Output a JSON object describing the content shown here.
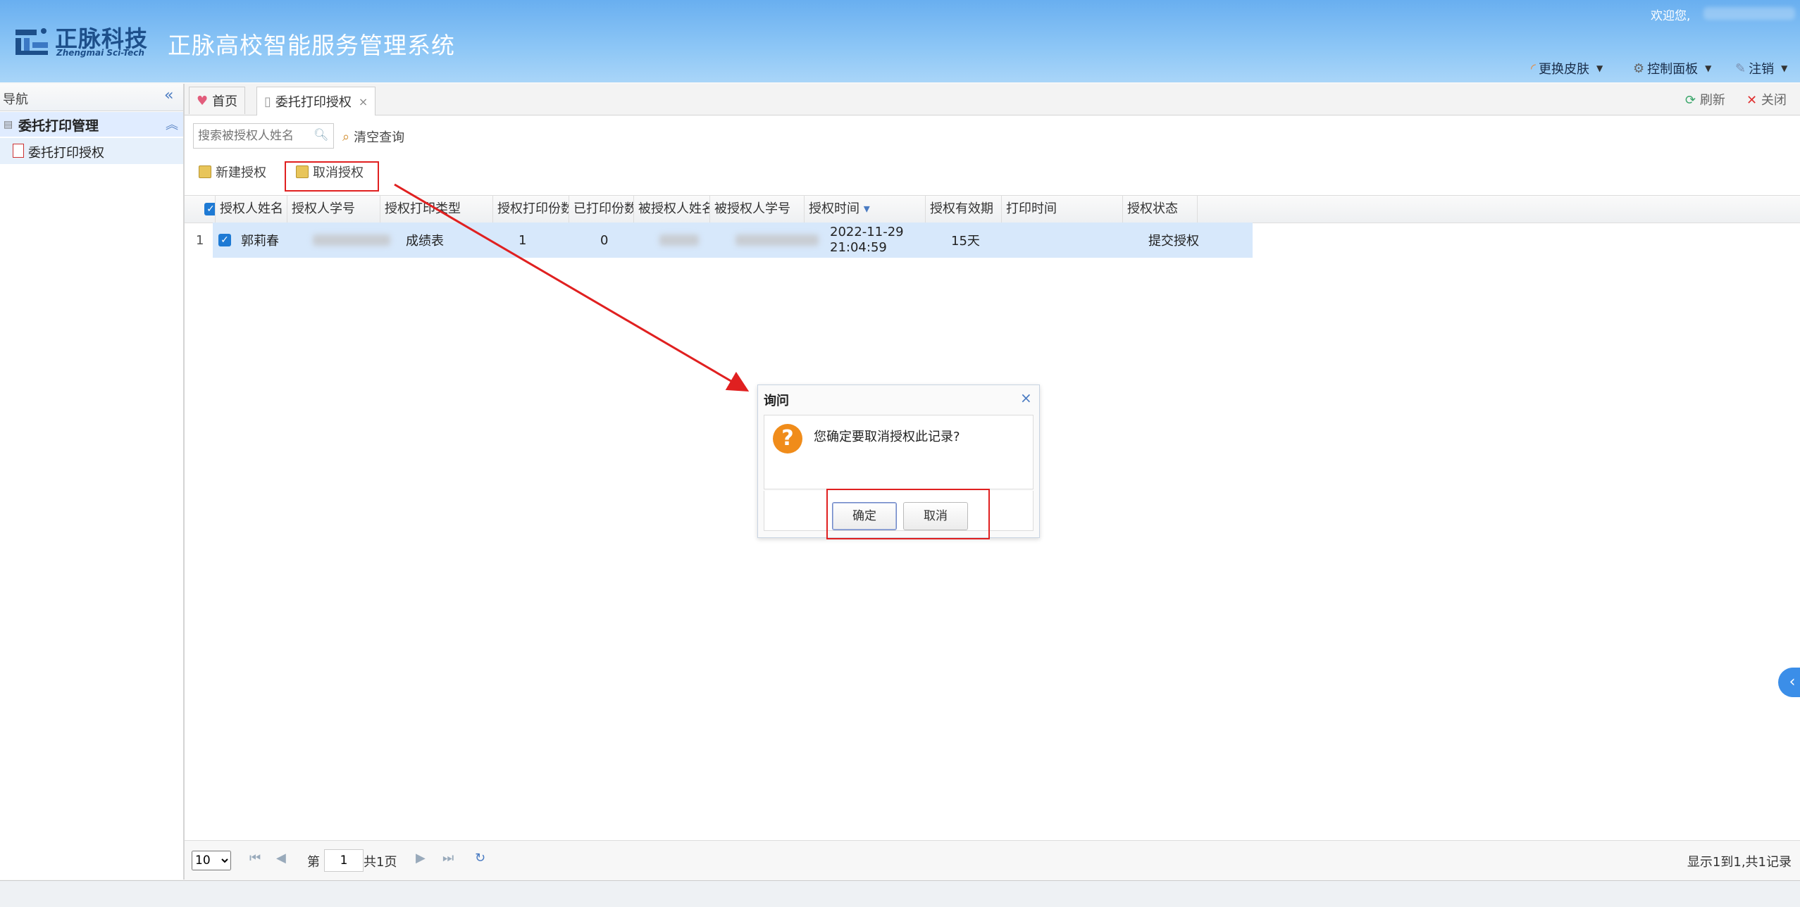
{
  "header": {
    "logo_cn": "正脉科技",
    "logo_en": "Zhengmai Sci-Tech",
    "system_title": "正脉高校智能服务管理系统",
    "welcome": "欢迎您,",
    "menus": [
      "更换皮肤",
      "控制面板",
      "注销"
    ]
  },
  "nav": {
    "title": "导航",
    "group": "委托打印管理",
    "item": "委托打印授权"
  },
  "tabs": {
    "home": "首页",
    "active": "委托打印授权",
    "close_symbol": "×",
    "refresh": "刷新",
    "close": "关闭"
  },
  "toolbar": {
    "search_placeholder": "搜索被授权人姓名",
    "clear": "清空查询",
    "new": "新建授权",
    "cancel": "取消授权"
  },
  "grid": {
    "columns": [
      "授权人姓名",
      "授权人学号",
      "授权打印类型",
      "授权打印份数",
      "已打印份数",
      "被授权人姓名",
      "被授权人学号",
      "授权时间",
      "授权有效期",
      "打印时间",
      "授权状态"
    ],
    "sort_indicator": "▾",
    "row": {
      "index": "1",
      "grantor_name": "郭莉春",
      "print_type": "成绩表",
      "print_count": "1",
      "printed": "0",
      "time_date": "2022-11-29",
      "time_clock": "21:04:59",
      "validity": "15天",
      "status": "提交授权"
    }
  },
  "pager": {
    "page_size": "10",
    "page_prefix": "第",
    "page_value": "1",
    "page_suffix": "共1页",
    "info": "显示1到1,共1记录"
  },
  "dialog": {
    "title": "询问",
    "message": "您确定要取消授权此记录?",
    "ok": "确定",
    "cancel": "取消"
  },
  "colors": {
    "header_blue": "#69aff0",
    "highlight_red": "#e02020",
    "selected_row": "#d7e8fb",
    "question_orange": "#f08c1a"
  }
}
